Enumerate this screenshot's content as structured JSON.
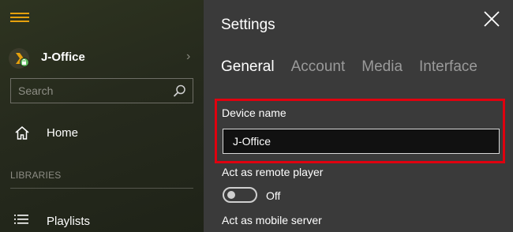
{
  "colors": {
    "accent": "#e5a00d",
    "panel_bg": "#3a3a3a",
    "highlight_border": "#e0000f"
  },
  "sidebar": {
    "menu_icon": "hamburger-icon",
    "server": {
      "name": "J-Office",
      "logo": "plex-logo",
      "badge": "lock-icon",
      "chevron": "›"
    },
    "search": {
      "placeholder": "Search",
      "value": "",
      "icon": "search-icon"
    },
    "nav": [
      {
        "label": "Home",
        "icon": "home-icon"
      }
    ],
    "section_label": "LIBRARIES",
    "libraries": [
      {
        "label": "Playlists",
        "icon": "list-icon"
      }
    ]
  },
  "settings": {
    "title": "Settings",
    "close_icon": "close-icon",
    "tabs": [
      {
        "label": "General",
        "active": true
      },
      {
        "label": "Account",
        "active": false
      },
      {
        "label": "Media",
        "active": false
      },
      {
        "label": "Interface",
        "active": false
      }
    ],
    "device_name": {
      "label": "Device name",
      "value": "J-Office"
    },
    "remote_player": {
      "label": "Act as remote player",
      "toggle_state": "Off",
      "enabled": false
    },
    "mobile_server": {
      "label": "Act as mobile server"
    }
  }
}
